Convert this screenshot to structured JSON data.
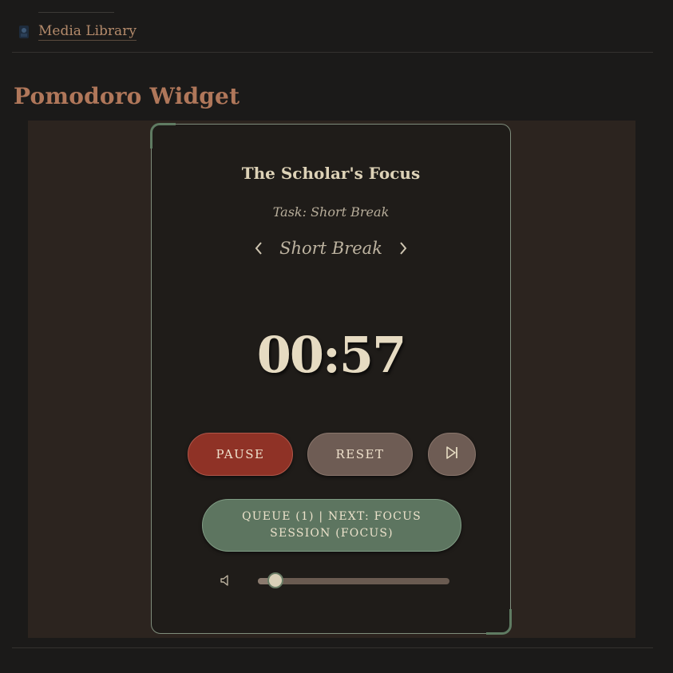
{
  "breadcrumb": {
    "icon": "media-library-icon",
    "label": "Media Library"
  },
  "page": {
    "title": "Pomodoro Widget"
  },
  "widget": {
    "title": "The Scholar's Focus",
    "task": "Task: Short Break",
    "mode": {
      "label": "Short Break",
      "prev_icon": "chevron-left-icon",
      "next_icon": "chevron-right-icon"
    },
    "timer": "00:57",
    "buttons": {
      "pause": "PAUSE",
      "reset": "RESET",
      "skip_icon": "skip-next-icon"
    },
    "queue": "QUEUE (1) | NEXT: FOCUS SESSION (FOCUS)",
    "volume": {
      "icon": "volume-mute-icon",
      "level": 0.09
    }
  },
  "colors": {
    "accent": "#b0775a",
    "pause": "#8f3226",
    "reset": "#6e5c54",
    "queue": "#5d7560",
    "text": "#e6dbc2"
  }
}
